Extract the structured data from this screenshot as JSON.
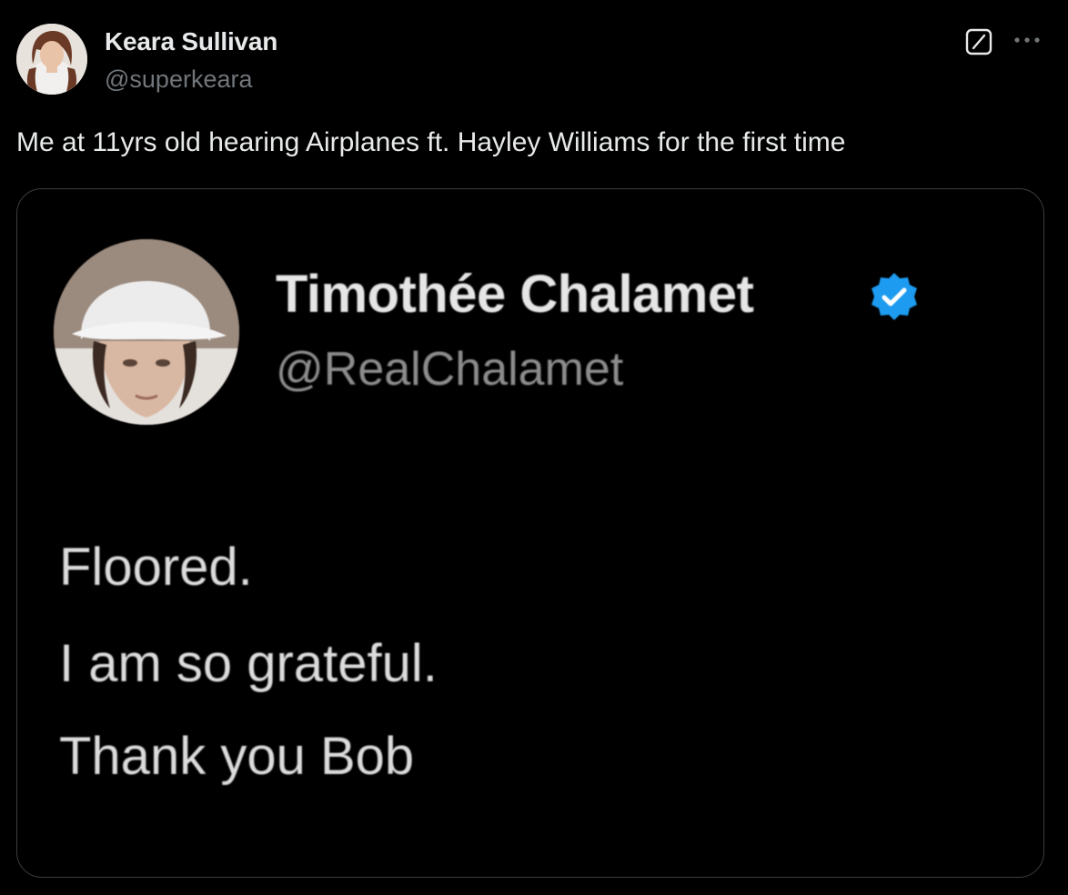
{
  "author": {
    "name": "Keara Sullivan",
    "handle": "@superkeara",
    "avatar_icon": "profile-photo"
  },
  "actions": {
    "grok_icon": "grok-icon",
    "more_icon": "more-horizontal-icon"
  },
  "tweet": {
    "text": "Me at 11yrs old hearing Airplanes ft. Hayley Williams for the first time"
  },
  "embedded_image": {
    "name": "Timothée Chalamet",
    "handle": "@RealChalamet",
    "verified_icon": "verified-badge-icon",
    "badge_color": "#1d9bf0",
    "lines": [
      "Floored.",
      "I am so grateful.",
      "Thank you Bob"
    ]
  },
  "colors": {
    "background": "#000000",
    "primary_text": "#e7e9ea",
    "secondary_text": "#71767b",
    "border": "#3a3d41"
  }
}
